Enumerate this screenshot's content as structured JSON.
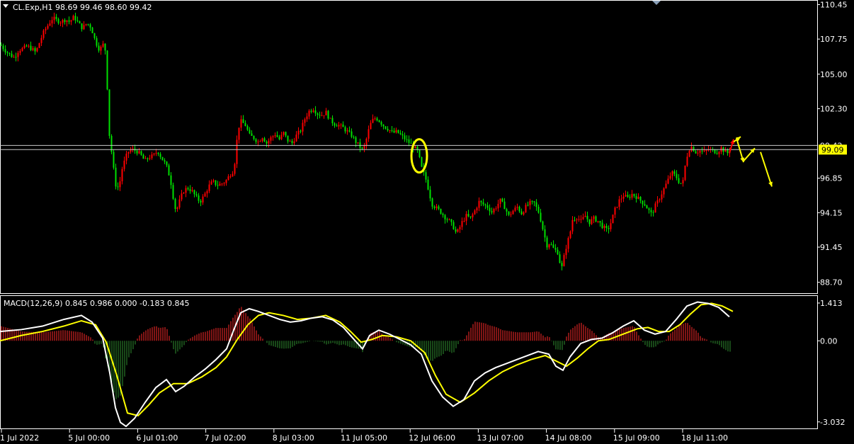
{
  "symbol_info": {
    "title": "CL.Exp,H1  98.69 99.46 98.60 99.42"
  },
  "colors": {
    "background": "#000000",
    "bull": "#ff0000",
    "bear": "#00e000",
    "grid_frame": "#ffffff",
    "annotation": "#ffff00",
    "macd_line": "#ffffff",
    "signal_line": "#ffff00",
    "hist_pos": "#ff2a2a",
    "hist_neg": "#2f8f2f",
    "current_price_bg": "#ffff00"
  },
  "chart_data": [
    {
      "type": "candlestick",
      "title": "CL.Exp,H1",
      "ohlc_last": {
        "open": 98.69,
        "high": 99.46,
        "low": 98.6,
        "close": 99.42
      },
      "ylim": [
        87.9,
        110.7
      ],
      "y_ticks": [
        "110.45",
        "107.75",
        "105.00",
        "102.30",
        "96.85",
        "94.15",
        "91.45",
        "88.70"
      ],
      "current_price_label": "99.09",
      "hidden_price_label": "99.42",
      "horizontal_lines": [
        99.42,
        99.09
      ],
      "x_ticks": [
        "1 Jul 2022",
        "5 Jul 00:00",
        "6 Jul 01:00",
        "7 Jul 02:00",
        "8 Jul 03:00",
        "11 Jul 05:00",
        "12 Jul 06:00",
        "13 Jul 07:00",
        "14 Jul 08:00",
        "15 Jul 09:00",
        "18 Jul 11:00"
      ],
      "close_path": [
        [
          0,
          107.3
        ],
        [
          8,
          106.8
        ],
        [
          14,
          106.5
        ],
        [
          20,
          106.3
        ],
        [
          26,
          106.9
        ],
        [
          32,
          107.0
        ],
        [
          38,
          107.2
        ],
        [
          44,
          107.0
        ],
        [
          50,
          106.7
        ],
        [
          56,
          107.6
        ],
        [
          62,
          108.4
        ],
        [
          68,
          108.9
        ],
        [
          74,
          109.4
        ],
        [
          80,
          109.2
        ],
        [
          86,
          109.1
        ],
        [
          92,
          109.3
        ],
        [
          98,
          109.1
        ],
        [
          104,
          109.5
        ],
        [
          110,
          109.0
        ],
        [
          116,
          108.6
        ],
        [
          122,
          109.0
        ],
        [
          128,
          108.7
        ],
        [
          134,
          107.6
        ],
        [
          140,
          106.9
        ],
        [
          146,
          107.4
        ],
        [
          150,
          106.4
        ],
        [
          152,
          101.5
        ],
        [
          155,
          99.6
        ],
        [
          158,
          98.6
        ],
        [
          161,
          97.0
        ],
        [
          164,
          96.0
        ],
        [
          168,
          96.3
        ],
        [
          172,
          97.6
        ],
        [
          176,
          98.3
        ],
        [
          180,
          98.9
        ],
        [
          186,
          99.1
        ],
        [
          192,
          99.0
        ],
        [
          198,
          98.7
        ],
        [
          204,
          98.2
        ],
        [
          210,
          98.5
        ],
        [
          216,
          98.6
        ],
        [
          222,
          99.0
        ],
        [
          228,
          98.4
        ],
        [
          234,
          97.9
        ],
        [
          240,
          96.8
        ],
        [
          244,
          95.4
        ],
        [
          248,
          94.2
        ],
        [
          252,
          94.9
        ],
        [
          258,
          95.8
        ],
        [
          264,
          96.1
        ],
        [
          270,
          95.9
        ],
        [
          276,
          95.4
        ],
        [
          282,
          95.0
        ],
        [
          288,
          95.5
        ],
        [
          294,
          96.2
        ],
        [
          300,
          96.6
        ],
        [
          306,
          96.3
        ],
        [
          312,
          96.4
        ],
        [
          318,
          96.6
        ],
        [
          324,
          97.1
        ],
        [
          330,
          97.5
        ],
        [
          333,
          99.3
        ],
        [
          336,
          100.8
        ],
        [
          340,
          101.3
        ],
        [
          346,
          101.0
        ],
        [
          352,
          100.2
        ],
        [
          358,
          100.0
        ],
        [
          364,
          99.7
        ],
        [
          370,
          100.1
        ],
        [
          376,
          99.6
        ],
        [
          382,
          100.0
        ],
        [
          388,
          100.3
        ],
        [
          394,
          99.9
        ],
        [
          400,
          100.4
        ],
        [
          406,
          99.8
        ],
        [
          412,
          99.6
        ],
        [
          418,
          100.2
        ],
        [
          424,
          100.6
        ],
        [
          430,
          101.5
        ],
        [
          436,
          102.1
        ],
        [
          442,
          102.3
        ],
        [
          448,
          101.9
        ],
        [
          454,
          101.8
        ],
        [
          460,
          102.0
        ],
        [
          466,
          101.4
        ],
        [
          472,
          101.1
        ],
        [
          478,
          101.0
        ],
        [
          484,
          100.8
        ],
        [
          490,
          100.5
        ],
        [
          496,
          100.2
        ],
        [
          502,
          99.7
        ],
        [
          508,
          99.3
        ],
        [
          512,
          99.0
        ],
        [
          516,
          99.7
        ],
        [
          520,
          100.6
        ],
        [
          524,
          101.3
        ],
        [
          530,
          101.6
        ],
        [
          536,
          101.3
        ],
        [
          542,
          100.9
        ],
        [
          548,
          100.7
        ],
        [
          554,
          100.4
        ],
        [
          560,
          100.5
        ],
        [
          566,
          100.2
        ],
        [
          572,
          99.9
        ],
        [
          578,
          99.6
        ],
        [
          584,
          99.3
        ],
        [
          590,
          98.9
        ],
        [
          594,
          97.8
        ],
        [
          598,
          97.2
        ],
        [
          602,
          96.6
        ],
        [
          606,
          95.6
        ],
        [
          610,
          94.8
        ],
        [
          616,
          94.5
        ],
        [
          622,
          94.2
        ],
        [
          628,
          93.8
        ],
        [
          634,
          93.5
        ],
        [
          640,
          93.0
        ],
        [
          644,
          92.5
        ],
        [
          648,
          92.9
        ],
        [
          652,
          93.4
        ],
        [
          658,
          93.9
        ],
        [
          664,
          93.7
        ],
        [
          670,
          94.3
        ],
        [
          676,
          95.0
        ],
        [
          682,
          94.8
        ],
        [
          688,
          94.6
        ],
        [
          694,
          94.2
        ],
        [
          700,
          94.6
        ],
        [
          706,
          95.1
        ],
        [
          712,
          94.6
        ],
        [
          718,
          93.9
        ],
        [
          724,
          94.3
        ],
        [
          730,
          94.6
        ],
        [
          736,
          94.1
        ],
        [
          742,
          94.6
        ],
        [
          748,
          94.9
        ],
        [
          754,
          94.9
        ],
        [
          760,
          94.2
        ],
        [
          764,
          93.4
        ],
        [
          768,
          92.4
        ],
        [
          772,
          91.6
        ],
        [
          776,
          91.8
        ],
        [
          780,
          91.4
        ],
        [
          784,
          91.2
        ],
        [
          788,
          91.0
        ],
        [
          792,
          89.6
        ],
        [
          796,
          90.7
        ],
        [
          800,
          91.7
        ],
        [
          804,
          92.4
        ],
        [
          808,
          93.6
        ],
        [
          814,
          93.8
        ],
        [
          820,
          93.5
        ],
        [
          826,
          93.9
        ],
        [
          832,
          93.4
        ],
        [
          838,
          93.7
        ],
        [
          844,
          93.5
        ],
        [
          850,
          93.1
        ],
        [
          856,
          92.8
        ],
        [
          860,
          93.0
        ],
        [
          864,
          93.7
        ],
        [
          868,
          94.4
        ],
        [
          874,
          95.1
        ],
        [
          880,
          95.5
        ],
        [
          886,
          95.3
        ],
        [
          892,
          95.6
        ],
        [
          898,
          95.4
        ],
        [
          904,
          95.1
        ],
        [
          910,
          94.8
        ],
        [
          916,
          94.3
        ],
        [
          920,
          94.0
        ],
        [
          924,
          94.6
        ],
        [
          930,
          95.2
        ],
        [
          936,
          95.9
        ],
        [
          942,
          96.6
        ],
        [
          948,
          97.3
        ],
        [
          954,
          97.0
        ],
        [
          960,
          96.4
        ],
        [
          964,
          96.6
        ],
        [
          968,
          98.2
        ],
        [
          972,
          99.1
        ],
        [
          976,
          99.3
        ],
        [
          982,
          98.9
        ],
        [
          988,
          99.0
        ],
        [
          994,
          98.9
        ],
        [
          1000,
          99.1
        ],
        [
          1006,
          99.0
        ],
        [
          1012,
          98.9
        ],
        [
          1018,
          99.2
        ],
        [
          1024,
          98.9
        ],
        [
          1028,
          98.8
        ],
        [
          1032,
          99.4
        ]
      ],
      "annotations": [
        {
          "type": "ellipse",
          "color": "#ffff00",
          "at_x": 592,
          "price_range": [
            97.3,
            99.9
          ]
        },
        {
          "type": "arrow",
          "color": "#ff0000",
          "from": [
            1030,
            98.8
          ],
          "to": [
            1036,
            99.9
          ]
        },
        {
          "type": "arrow",
          "color": "#ffff00",
          "from": [
            1036,
            99.7
          ],
          "to": [
            1046,
            100.1
          ]
        },
        {
          "type": "arrow",
          "color": "#ffff00",
          "from": [
            1040,
            100.0
          ],
          "to": [
            1050,
            98.1
          ]
        },
        {
          "type": "arrow",
          "color": "#ffff00",
          "from": [
            1050,
            98.2
          ],
          "to": [
            1066,
            99.2
          ]
        },
        {
          "type": "arrow",
          "color": "#ffff00",
          "from": [
            1074,
            98.9
          ],
          "to": [
            1090,
            96.2
          ]
        }
      ]
    },
    {
      "type": "macd",
      "title": "MACD(12,26,9) 0.845 0.986 0.000 -0.183 0.845",
      "ylim": [
        -3.25,
        1.65
      ],
      "y_ticks": [
        "1.413",
        "0.00",
        "-3.032"
      ],
      "macd_line": [
        [
          0,
          0.35
        ],
        [
          30,
          0.42
        ],
        [
          60,
          0.55
        ],
        [
          90,
          0.8
        ],
        [
          115,
          0.95
        ],
        [
          130,
          0.7
        ],
        [
          145,
          0.1
        ],
        [
          155,
          -1.2
        ],
        [
          163,
          -2.5
        ],
        [
          170,
          -3.05
        ],
        [
          178,
          -3.2
        ],
        [
          190,
          -2.9
        ],
        [
          205,
          -2.3
        ],
        [
          220,
          -1.75
        ],
        [
          235,
          -1.45
        ],
        [
          248,
          -1.9
        ],
        [
          260,
          -1.7
        ],
        [
          275,
          -1.35
        ],
        [
          290,
          -1.05
        ],
        [
          305,
          -0.7
        ],
        [
          320,
          -0.3
        ],
        [
          330,
          0.4
        ],
        [
          340,
          1.05
        ],
        [
          352,
          1.2
        ],
        [
          365,
          1.1
        ],
        [
          380,
          0.95
        ],
        [
          395,
          0.8
        ],
        [
          410,
          0.7
        ],
        [
          425,
          0.75
        ],
        [
          440,
          0.85
        ],
        [
          455,
          0.9
        ],
        [
          470,
          0.78
        ],
        [
          485,
          0.5
        ],
        [
          500,
          0.05
        ],
        [
          512,
          -0.3
        ],
        [
          522,
          0.2
        ],
        [
          535,
          0.4
        ],
        [
          550,
          0.25
        ],
        [
          565,
          0.05
        ],
        [
          580,
          -0.15
        ],
        [
          595,
          -0.5
        ],
        [
          610,
          -1.5
        ],
        [
          625,
          -2.1
        ],
        [
          640,
          -2.45
        ],
        [
          655,
          -2.2
        ],
        [
          670,
          -1.5
        ],
        [
          685,
          -1.2
        ],
        [
          700,
          -1.0
        ],
        [
          715,
          -0.85
        ],
        [
          730,
          -0.7
        ],
        [
          745,
          -0.55
        ],
        [
          760,
          -0.4
        ],
        [
          775,
          -0.5
        ],
        [
          785,
          -0.95
        ],
        [
          795,
          -1.1
        ],
        [
          805,
          -0.6
        ],
        [
          820,
          -0.1
        ],
        [
          835,
          0.05
        ],
        [
          850,
          0.1
        ],
        [
          865,
          0.3
        ],
        [
          880,
          0.55
        ],
        [
          895,
          0.75
        ],
        [
          910,
          0.4
        ],
        [
          925,
          0.25
        ],
        [
          940,
          0.35
        ],
        [
          955,
          0.8
        ],
        [
          970,
          1.3
        ],
        [
          985,
          1.45
        ],
        [
          1000,
          1.4
        ],
        [
          1015,
          1.25
        ],
        [
          1030,
          0.9
        ]
      ],
      "signal_line": [
        [
          0,
          0.0
        ],
        [
          30,
          0.2
        ],
        [
          60,
          0.35
        ],
        [
          90,
          0.55
        ],
        [
          115,
          0.75
        ],
        [
          135,
          0.6
        ],
        [
          150,
          -0.05
        ],
        [
          165,
          -1.3
        ],
        [
          180,
          -2.7
        ],
        [
          195,
          -2.8
        ],
        [
          210,
          -2.4
        ],
        [
          225,
          -1.95
        ],
        [
          245,
          -1.6
        ],
        [
          265,
          -1.6
        ],
        [
          285,
          -1.35
        ],
        [
          305,
          -1.0
        ],
        [
          320,
          -0.6
        ],
        [
          335,
          0.05
        ],
        [
          350,
          0.6
        ],
        [
          365,
          0.95
        ],
        [
          380,
          1.05
        ],
        [
          400,
          0.95
        ],
        [
          420,
          0.8
        ],
        [
          440,
          0.85
        ],
        [
          460,
          0.95
        ],
        [
          480,
          0.7
        ],
        [
          495,
          0.35
        ],
        [
          510,
          -0.05
        ],
        [
          525,
          0.05
        ],
        [
          540,
          0.2
        ],
        [
          560,
          0.15
        ],
        [
          580,
          0.0
        ],
        [
          600,
          -0.45
        ],
        [
          615,
          -1.3
        ],
        [
          630,
          -2.0
        ],
        [
          650,
          -2.3
        ],
        [
          670,
          -1.95
        ],
        [
          690,
          -1.5
        ],
        [
          710,
          -1.15
        ],
        [
          730,
          -0.9
        ],
        [
          750,
          -0.7
        ],
        [
          770,
          -0.55
        ],
        [
          785,
          -0.75
        ],
        [
          800,
          -0.95
        ],
        [
          815,
          -0.65
        ],
        [
          830,
          -0.3
        ],
        [
          845,
          0.0
        ],
        [
          860,
          0.05
        ],
        [
          880,
          0.25
        ],
        [
          900,
          0.45
        ],
        [
          915,
          0.5
        ],
        [
          930,
          0.35
        ],
        [
          945,
          0.35
        ],
        [
          960,
          0.6
        ],
        [
          975,
          1.0
        ],
        [
          990,
          1.35
        ],
        [
          1005,
          1.4
        ],
        [
          1020,
          1.3
        ],
        [
          1035,
          1.1
        ]
      ],
      "histogram_note": "difference (macd - signal) drawn as thin red/green bars"
    }
  ]
}
